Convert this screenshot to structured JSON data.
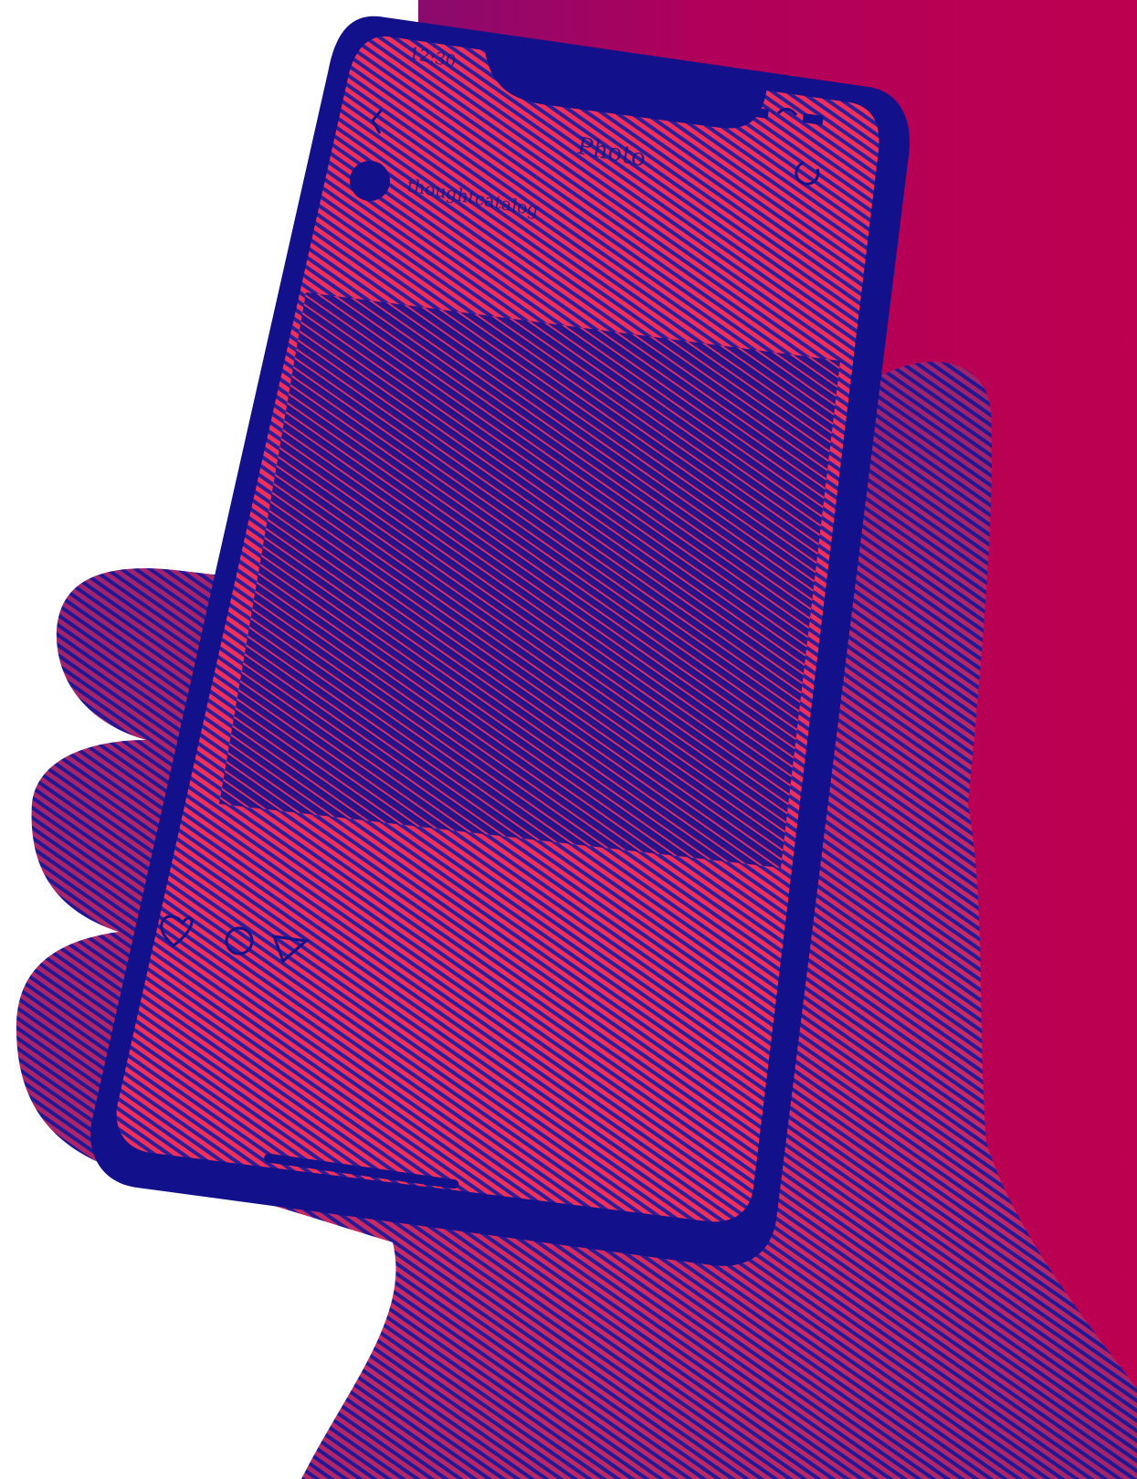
{
  "photo": {
    "colors": {
      "background_left": "#ffffff",
      "background_gradient": [
        "#8a0a6e",
        "#b0005a",
        "#bd0050"
      ],
      "line_pink": "#f0305a",
      "line_navy": "#0c0a8a"
    },
    "phone_screen": {
      "status_time": "12:30",
      "header_title": "Photo",
      "username": "thoughtcatalog",
      "icons": [
        "back-chevron-icon",
        "refresh-icon",
        "signal-icon",
        "wifi-icon",
        "battery-icon",
        "avatar-icon",
        "heart-icon",
        "comment-icon",
        "share-icon"
      ]
    }
  }
}
